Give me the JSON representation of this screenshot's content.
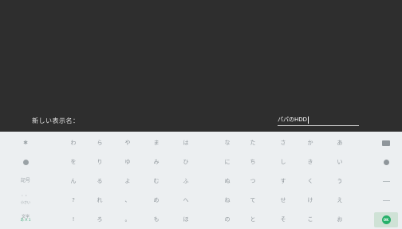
{
  "dialog": {
    "label": "新しい表示名：",
    "input_value": "パパのHDD"
  },
  "keyboard": {
    "row1": [
      "わ",
      "ら",
      "や",
      "ま",
      "は",
      "な",
      "た",
      "さ",
      "か",
      "あ"
    ],
    "row2": [
      "を",
      "り",
      "ゆ",
      "み",
      "ひ",
      "に",
      "ち",
      "し",
      "き",
      "い"
    ],
    "row3": [
      "ん",
      "る",
      "よ",
      "む",
      "ふ",
      "ぬ",
      "つ",
      "す",
      "く",
      "う"
    ],
    "row4": [
      "?",
      "れ",
      "、",
      "め",
      "へ",
      "ね",
      "て",
      "せ",
      "け",
      "え"
    ],
    "row5": [
      "!",
      "ろ",
      "。",
      "も",
      "ほ",
      "の",
      "と",
      "そ",
      "こ",
      "お"
    ],
    "side": {
      "symbols_label": "記号",
      "small_kana_top": "゛゜",
      "small_kana_bottom": "小さい",
      "mode_top": "文字",
      "mode_bottom": "あ A 1",
      "enter_label": "OK"
    },
    "icons": {
      "row1_left": "star-icon",
      "row2_left": "globe-icon",
      "row1_right": "backspace-icon",
      "row2_right": "cursor-right-icon",
      "row3_right": "dash-icon",
      "row4_right": "dash-icon",
      "enter": "enter-icon"
    },
    "colors": {
      "background": "#eceff1",
      "key_text": "#8f969b",
      "accent": "#26b06a"
    }
  }
}
